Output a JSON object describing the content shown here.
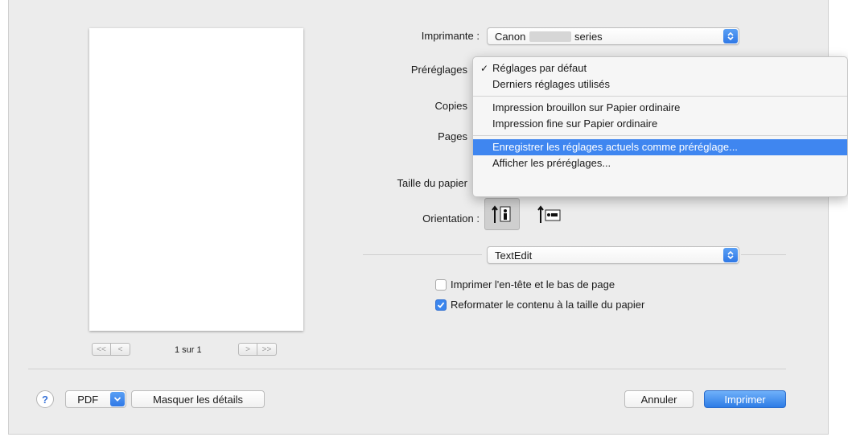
{
  "preview": {
    "page_count": "1 sur 1",
    "nav_first": "<<",
    "nav_prev": "<",
    "nav_next": ">",
    "nav_last": ">>"
  },
  "settings": {
    "printer_label": "Imprimante :",
    "printer_value_prefix": "Canon",
    "printer_value_suffix": "series",
    "presets_label": "Préréglages",
    "copies_label": "Copies",
    "pages_label": "Pages",
    "paper_size_label": "Taille du papier",
    "orientation_label": "Orientation :",
    "app_section_value": "TextEdit"
  },
  "presets_menu": {
    "items": [
      {
        "label": "Réglages par défaut",
        "checked": true
      },
      {
        "label": "Derniers réglages utilisés"
      },
      {
        "label": "Impression brouillon sur Papier ordinaire"
      },
      {
        "label": "Impression fine sur Papier ordinaire"
      },
      {
        "label": "Enregistrer les réglages actuels comme préréglage...",
        "highlighted": true
      },
      {
        "label": "Afficher les préréglages..."
      }
    ],
    "check_mark": "✓"
  },
  "options": {
    "header_footer_label": "Imprimer l'en-tête et le bas de page",
    "header_footer_checked": false,
    "rewrap_label": "Reformater le contenu à la taille du papier",
    "rewrap_checked": true
  },
  "footer": {
    "help_label": "?",
    "pdf_label": "PDF",
    "hide_details_label": "Masquer les détails",
    "cancel_label": "Annuler",
    "print_label": "Imprimer"
  },
  "colors": {
    "accent": "#3f86f0",
    "dialog_bg": "#ececec"
  }
}
